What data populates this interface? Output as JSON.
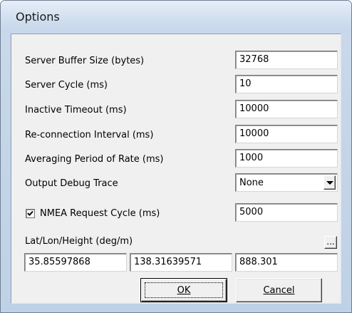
{
  "window": {
    "title": "Options"
  },
  "fields": {
    "server_buffer_size": {
      "label": "Server Buffer Size (bytes)",
      "value": "32768"
    },
    "server_cycle": {
      "label": "Server Cycle  (ms)",
      "value": "10"
    },
    "inactive_timeout": {
      "label": "Inactive Timeout  (ms)",
      "value": "10000"
    },
    "reconnection_interval": {
      "label": "Re-connection Interval  (ms)",
      "value": "10000"
    },
    "averaging_period": {
      "label": "Averaging Period of Rate (ms)",
      "value": "1000"
    },
    "output_debug_trace": {
      "label": "Output Debug Trace",
      "value": "None"
    },
    "nmea_request_cycle": {
      "label": "NMEA Request Cycle (ms)",
      "value": "5000",
      "checked": true
    },
    "lat_lon_height": {
      "label": "Lat/Lon/Height (deg/m)",
      "browse_label": "...",
      "lat": "35.85597868",
      "lon": "138.31639571",
      "height": "888.301"
    }
  },
  "buttons": {
    "ok": "OK",
    "cancel": "Cancel"
  },
  "icons": {
    "dropdown": "chevron-down-icon",
    "checkbox": "check-icon"
  },
  "colors": {
    "frame": "#c8d8ea",
    "client": "#f0f0f0"
  }
}
